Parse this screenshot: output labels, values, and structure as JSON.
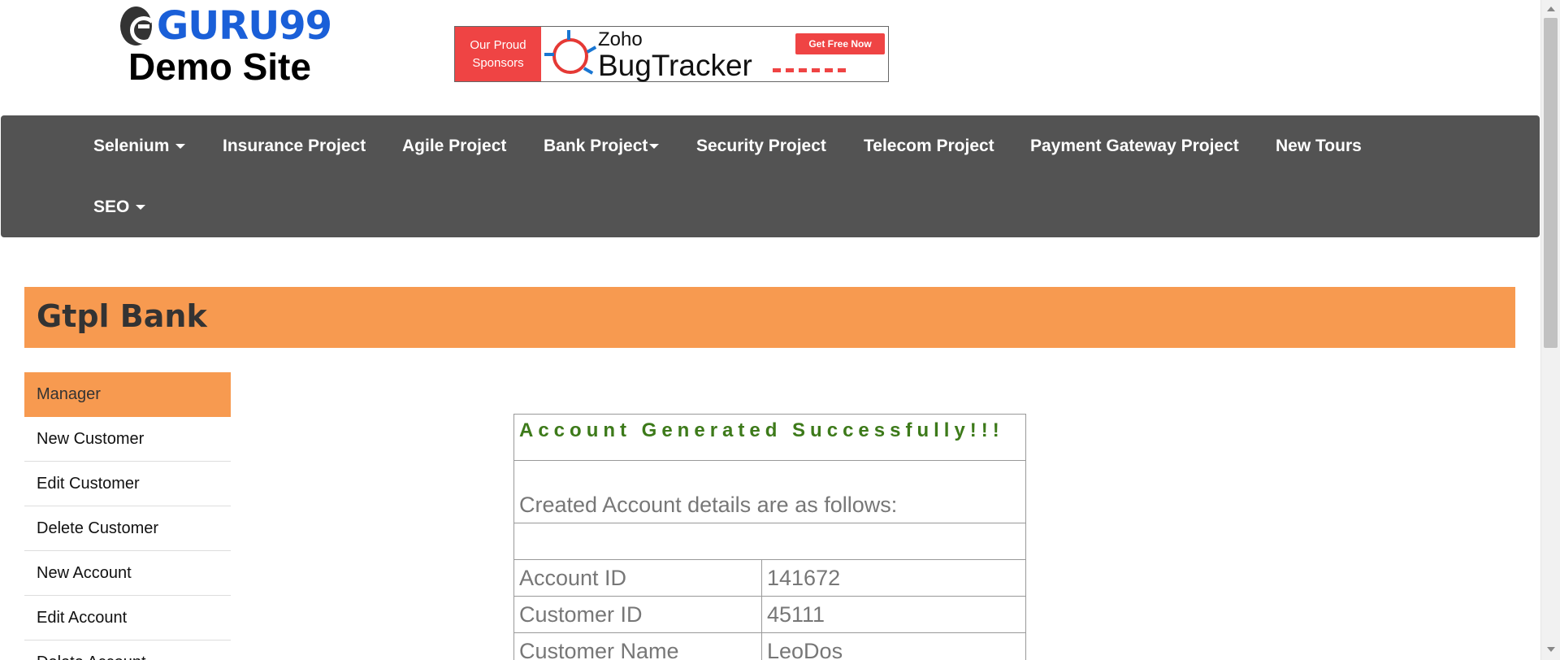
{
  "logo": {
    "brand": "GURU99",
    "subtitle": "Demo Site"
  },
  "ad": {
    "sponsor_line1": "Our Proud",
    "sponsor_line2": "Sponsors",
    "product_company": "Zoho",
    "product_name": "BugTracker",
    "cta": "Get Free Now"
  },
  "nav": {
    "items": [
      {
        "label": "Selenium",
        "dropdown": true
      },
      {
        "label": "Insurance Project",
        "dropdown": false
      },
      {
        "label": "Agile Project",
        "dropdown": false
      },
      {
        "label": "Bank Project",
        "dropdown": true
      },
      {
        "label": "Security Project",
        "dropdown": false
      },
      {
        "label": "Telecom Project",
        "dropdown": false
      },
      {
        "label": "Payment Gateway Project",
        "dropdown": false
      },
      {
        "label": "New Tours",
        "dropdown": false
      },
      {
        "label": "SEO",
        "dropdown": true
      }
    ]
  },
  "bank": {
    "title": "Gtpl Bank"
  },
  "sidebar": {
    "items": [
      {
        "label": "Manager",
        "active": true
      },
      {
        "label": "New Customer",
        "active": false
      },
      {
        "label": "Edit Customer",
        "active": false
      },
      {
        "label": "Delete Customer",
        "active": false
      },
      {
        "label": "New Account",
        "active": false
      },
      {
        "label": "Edit Account",
        "active": false
      },
      {
        "label": "Delete Account",
        "active": false
      }
    ]
  },
  "result": {
    "heading": "Account Generated Successfully!!!",
    "subheading": "Created Account details are as follows:",
    "rows": [
      {
        "label": "Account ID",
        "value": "141672"
      },
      {
        "label": "Customer ID",
        "value": "45111"
      },
      {
        "label": "Customer Name",
        "value": "LeoDos"
      }
    ]
  },
  "colors": {
    "accent_orange": "#f79a50",
    "navbar_bg": "#535353",
    "brand_blue": "#1a5fd8",
    "success_green": "#3d7a1a",
    "sponsor_red": "#ef4444"
  }
}
